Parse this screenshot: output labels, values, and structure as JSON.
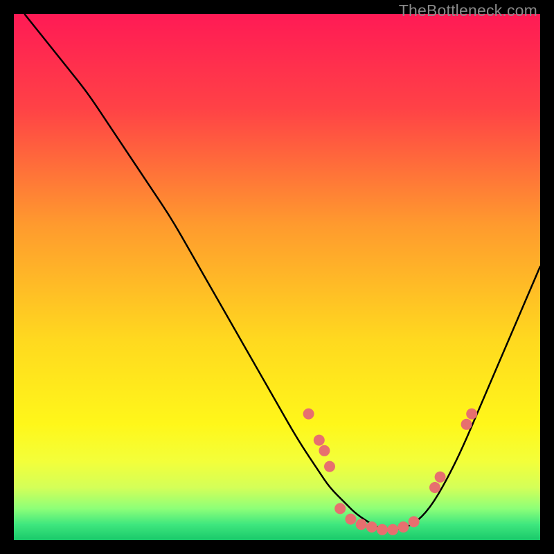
{
  "watermark": "TheBottleneck.com",
  "chart_data": {
    "type": "line",
    "title": "",
    "xlabel": "",
    "ylabel": "",
    "xlim": [
      0,
      100
    ],
    "ylim": [
      0,
      100
    ],
    "grid": false,
    "legend": false,
    "gradient_stops": [
      {
        "offset": 0.0,
        "color": "#ff1a55"
      },
      {
        "offset": 0.18,
        "color": "#ff4246"
      },
      {
        "offset": 0.4,
        "color": "#ff9a2e"
      },
      {
        "offset": 0.62,
        "color": "#ffd91f"
      },
      {
        "offset": 0.78,
        "color": "#fff71a"
      },
      {
        "offset": 0.85,
        "color": "#f3ff3a"
      },
      {
        "offset": 0.9,
        "color": "#d4ff58"
      },
      {
        "offset": 0.94,
        "color": "#8dff78"
      },
      {
        "offset": 0.97,
        "color": "#3fe77e"
      },
      {
        "offset": 1.0,
        "color": "#19c96a"
      }
    ],
    "series": [
      {
        "name": "bottleneck-curve",
        "x": [
          2,
          6,
          10,
          14,
          18,
          22,
          26,
          30,
          34,
          38,
          42,
          46,
          50,
          54,
          58,
          60,
          63,
          65,
          68,
          70,
          73,
          76,
          79,
          82,
          85,
          88,
          91,
          94,
          97,
          100
        ],
        "y": [
          100,
          95,
          90,
          85,
          79,
          73,
          67,
          61,
          54,
          47,
          40,
          33,
          26,
          19,
          13,
          10,
          7,
          5,
          3,
          2,
          2,
          3,
          6,
          11,
          17,
          24,
          31,
          38,
          45,
          52
        ]
      }
    ],
    "markers": {
      "name": "highlight-points",
      "color": "#e76f6f",
      "radius": 8,
      "points": [
        {
          "x": 56,
          "y": 24
        },
        {
          "x": 58,
          "y": 19
        },
        {
          "x": 59,
          "y": 17
        },
        {
          "x": 60,
          "y": 14
        },
        {
          "x": 62,
          "y": 6
        },
        {
          "x": 64,
          "y": 4
        },
        {
          "x": 66,
          "y": 3
        },
        {
          "x": 68,
          "y": 2.5
        },
        {
          "x": 70,
          "y": 2
        },
        {
          "x": 72,
          "y": 2
        },
        {
          "x": 74,
          "y": 2.5
        },
        {
          "x": 76,
          "y": 3.5
        },
        {
          "x": 80,
          "y": 10
        },
        {
          "x": 81,
          "y": 12
        },
        {
          "x": 86,
          "y": 22
        },
        {
          "x": 87,
          "y": 24
        }
      ]
    }
  }
}
